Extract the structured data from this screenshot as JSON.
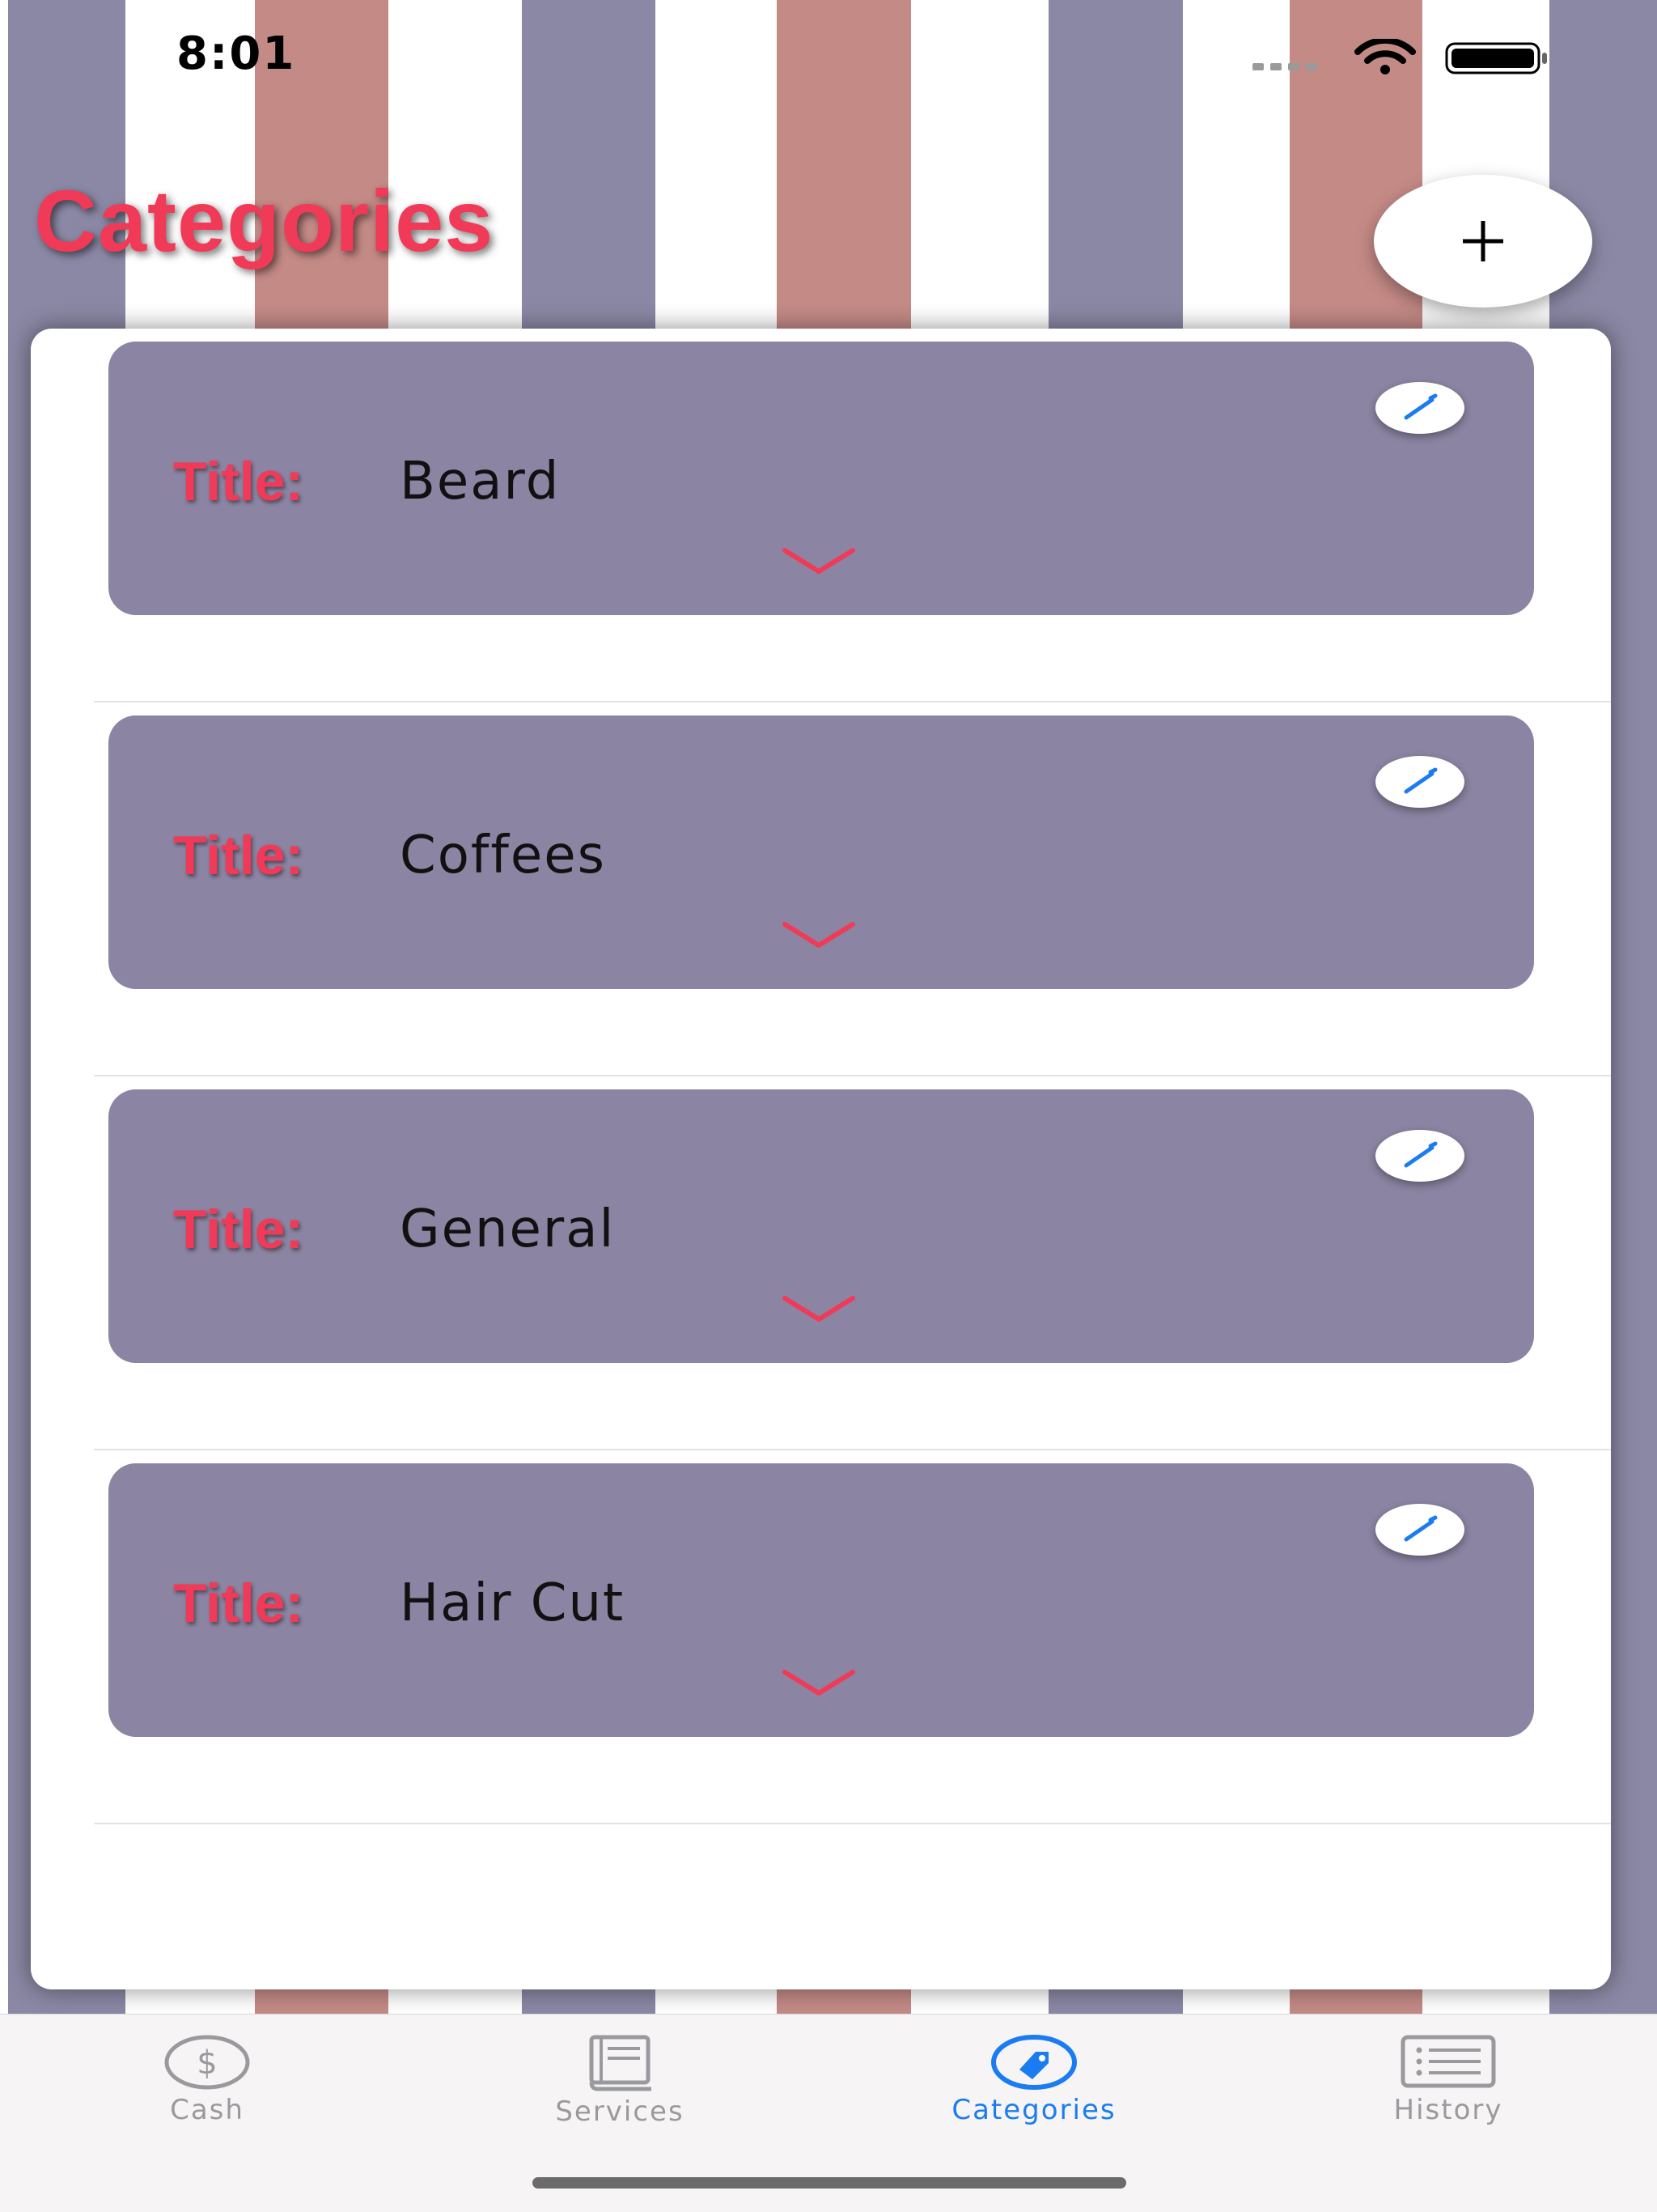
{
  "status_bar": {
    "time": "8:01"
  },
  "header": {
    "title": "Categories",
    "add_symbol": "+"
  },
  "categories": [
    {
      "label": "Title:",
      "value": "Beard"
    },
    {
      "label": "Title:",
      "value": "Coffees"
    },
    {
      "label": "Title:",
      "value": "General"
    },
    {
      "label": "Title:",
      "value": "Hair Cut"
    }
  ],
  "tabbar": {
    "tabs": [
      {
        "label": "Cash",
        "icon": "dollar-circle-icon",
        "active": false
      },
      {
        "label": "Services",
        "icon": "book-icon",
        "active": false
      },
      {
        "label": "Categories",
        "icon": "tag-icon",
        "active": true
      },
      {
        "label": "History",
        "icon": "list-icon",
        "active": false
      }
    ],
    "active_color": "#1a7cf0",
    "inactive_color": "#9a9a9e"
  },
  "colors": {
    "card": "#8b84a2",
    "title_accent": "#f03a57",
    "edit_icon": "#1a7cf0"
  }
}
